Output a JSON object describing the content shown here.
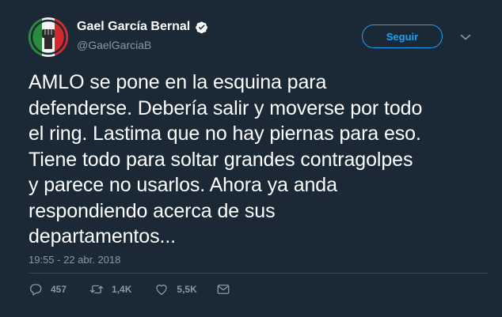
{
  "user": {
    "display_name": "Gael García Bernal",
    "handle": "@GaelGarciaB",
    "verified": true
  },
  "follow_button": {
    "label": "Seguir"
  },
  "tweet": {
    "lines": [
      "AMLO se pone en la esquina para",
      "defenderse. Debería salir y moverse por todo",
      "el ring. Lastima que no hay piernas para eso.",
      "Tiene todo para soltar grandes contragolpes",
      "y parece no usarlos. Ahora ya anda",
      "respondiendo acerca de sus",
      "departamentos..."
    ],
    "timestamp": "19:55 - 22 abr. 2018"
  },
  "actions": {
    "replies": "457",
    "retweets": "1,4K",
    "likes": "5,5K"
  },
  "icons": [
    "verified-icon",
    "chevron-down-icon",
    "reply-icon",
    "retweet-icon",
    "like-icon",
    "message-icon"
  ],
  "colors": {
    "background": "#1b2836",
    "accent": "#1da1f2",
    "muted": "#8899a6",
    "text": "#ffffff"
  }
}
